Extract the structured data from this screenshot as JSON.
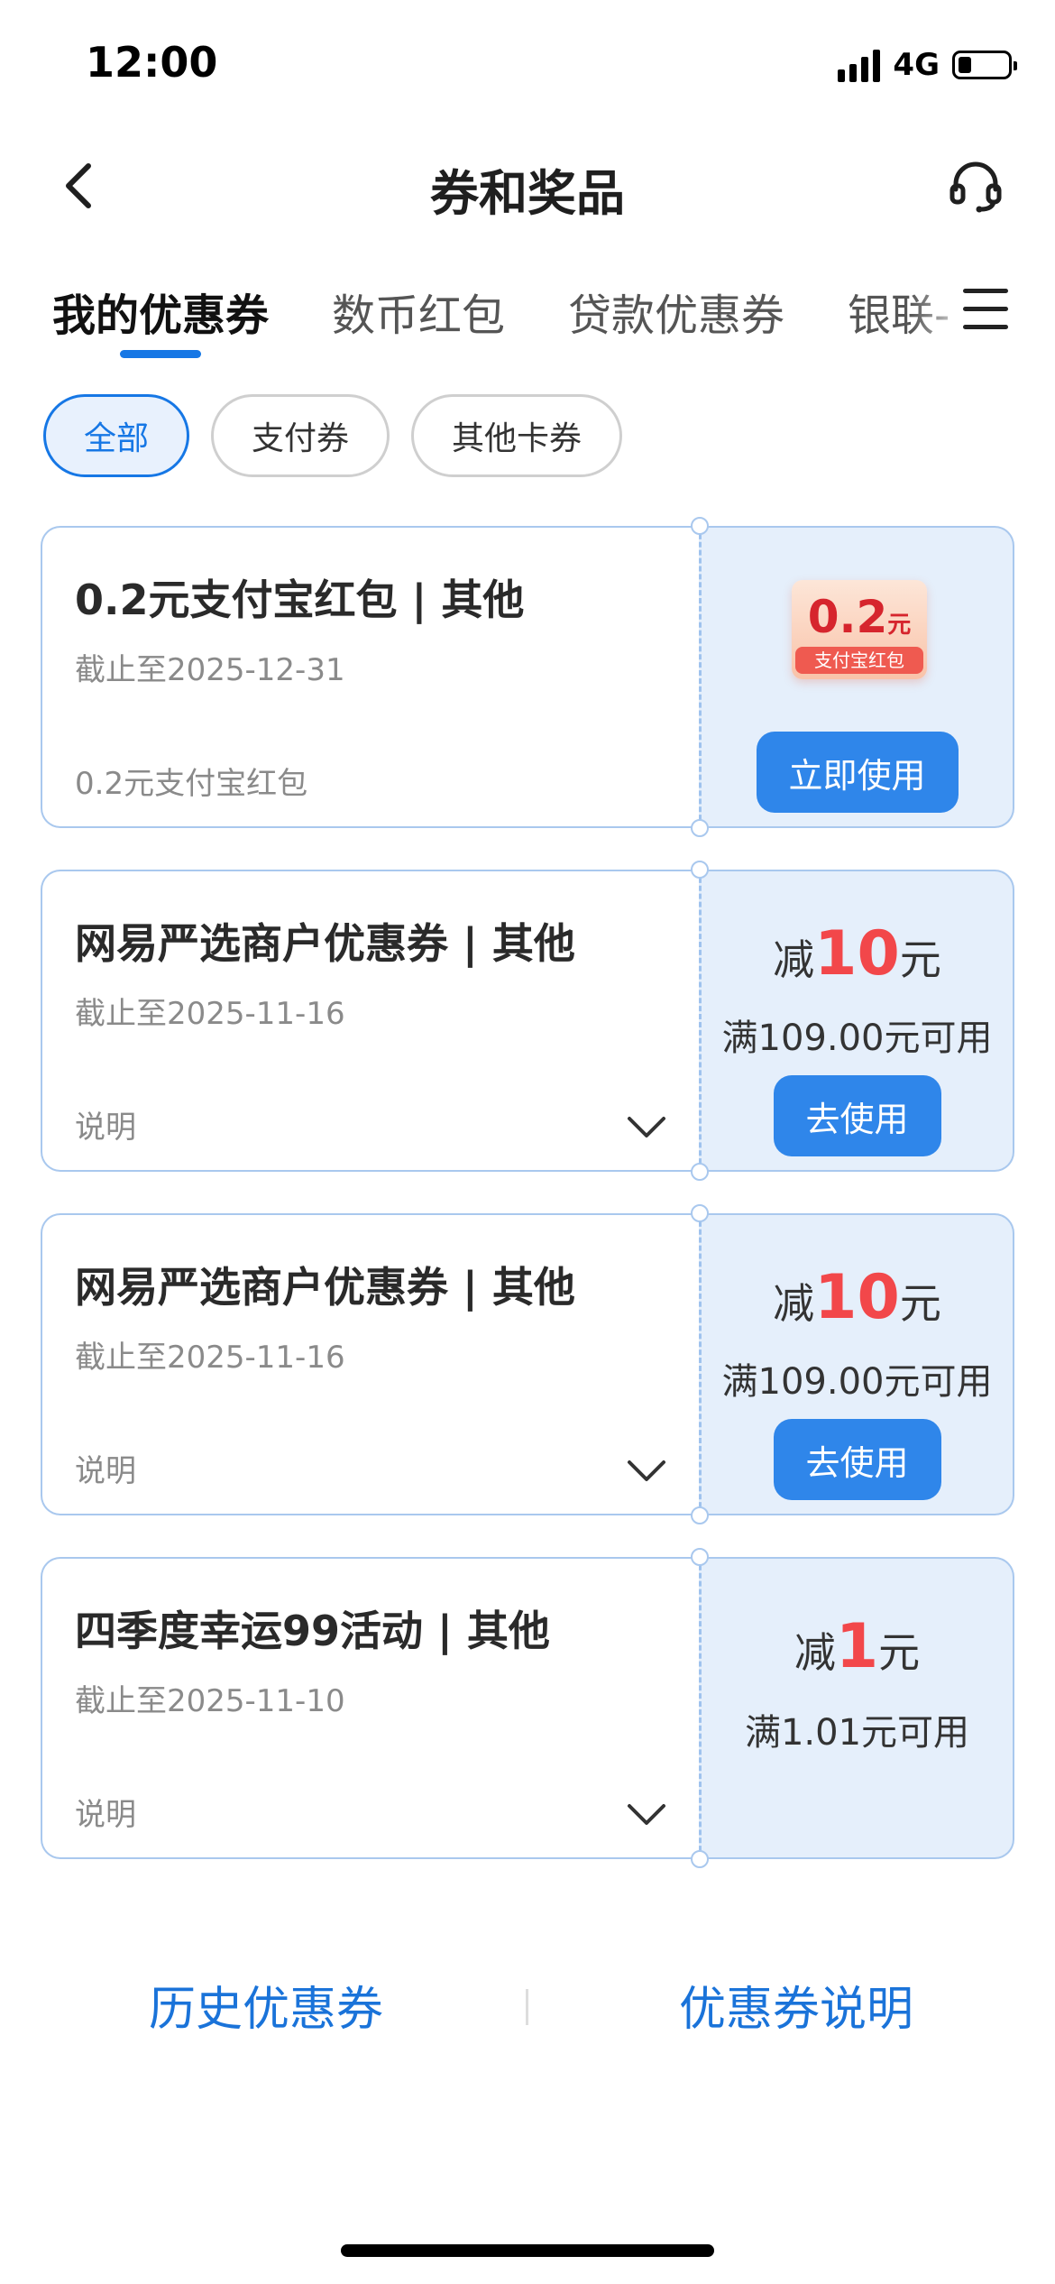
{
  "status_bar": {
    "time": "12:00",
    "network": "4G"
  },
  "header": {
    "title": "券和奖品"
  },
  "tabs": [
    {
      "label": "我的优惠券",
      "active": true
    },
    {
      "label": "数币红包",
      "active": false
    },
    {
      "label": "贷款优惠券",
      "active": false
    },
    {
      "label": "银联-",
      "active": false
    }
  ],
  "filters": [
    {
      "label": "全部",
      "active": true
    },
    {
      "label": "支付券",
      "active": false
    },
    {
      "label": "其他卡券",
      "active": false
    }
  ],
  "coupons": [
    {
      "title": "0.2元支付宝红包 |  其他",
      "expiry": "截止至2025-12-31",
      "description": "0.2元支付宝红包",
      "badge": {
        "amount": "0.2",
        "unit": "元",
        "label": "支付宝红包"
      },
      "action": "立即使用"
    },
    {
      "title": "网易严选商户优惠券 | 其他",
      "expiry": "截止至2025-11-16",
      "description": "说明",
      "discount": {
        "prefix": "减",
        "value": "10",
        "unit": "元"
      },
      "condition": "满109.00元可用",
      "action": "去使用"
    },
    {
      "title": "网易严选商户优惠券 | 其他",
      "expiry": "截止至2025-11-16",
      "description": "说明",
      "discount": {
        "prefix": "减",
        "value": "10",
        "unit": "元"
      },
      "condition": "满109.00元可用",
      "action": "去使用"
    },
    {
      "title": "四季度幸运99活动 | 其他",
      "expiry": "截止至2025-11-10",
      "description": "说明",
      "discount": {
        "prefix": "减",
        "value": "1",
        "unit": "元"
      },
      "condition": "满1.01元可用"
    }
  ],
  "footer": {
    "history_link": "历史优惠券",
    "rules_link": "优惠券说明"
  },
  "colors": {
    "accent": "#1677e5",
    "discount": "#f2474a",
    "card_right": "#e5effb"
  }
}
